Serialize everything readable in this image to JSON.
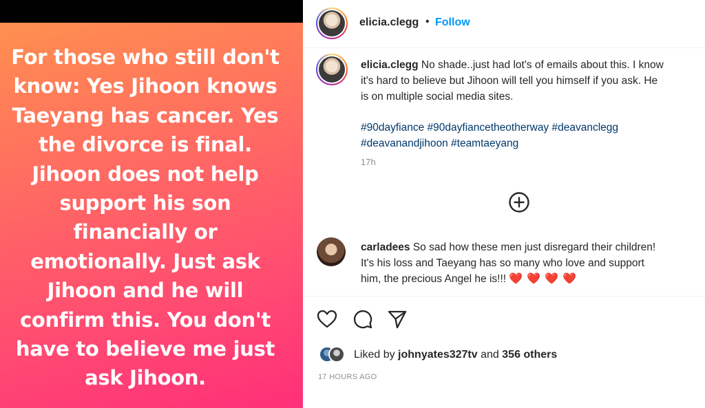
{
  "story": {
    "lines": [
      "For those who still don't",
      "know: Yes Jihoon knows",
      "Taeyang has cancer. Yes",
      "the divorce is final.",
      "Jihoon does not help",
      "support his son",
      "financially or",
      "emotionally. Just ask",
      "Jihoon and he will",
      "confirm this. You don't",
      "have to believe me just",
      "ask Jihoon."
    ]
  },
  "header": {
    "username": "elicia.clegg",
    "separator": "•",
    "follow_label": "Follow"
  },
  "caption": {
    "username": "elicia.clegg",
    "lines": [
      "No shade..just had lot's of emails about this. I know",
      "it's hard to believe but Jihoon will tell you himself if you ask. He",
      "is on multiple social media sites."
    ],
    "hashtags": [
      "#90dayfiance",
      "#90dayfiancetheotherway",
      "#deavanclegg",
      "#deavanandjihoon",
      "#teamtaeyang"
    ],
    "time": "17h"
  },
  "comment": {
    "username": "carladees",
    "lines": [
      "So sad how these men just disregard their children!",
      "It's his loss and Taeyang has so many who love and support",
      "him, the precious Angel he is!!!"
    ],
    "emoji": "❤️❤️❤️❤️"
  },
  "likes": {
    "prefix": "Liked by",
    "user": "johnyates327tv",
    "middle": "and",
    "others": "356 others"
  },
  "post_time": "17 HOURS AGO",
  "colors": {
    "link_blue": "#0095f6",
    "hashtag_blue": "#00376b",
    "muted": "#8e8e8e"
  }
}
